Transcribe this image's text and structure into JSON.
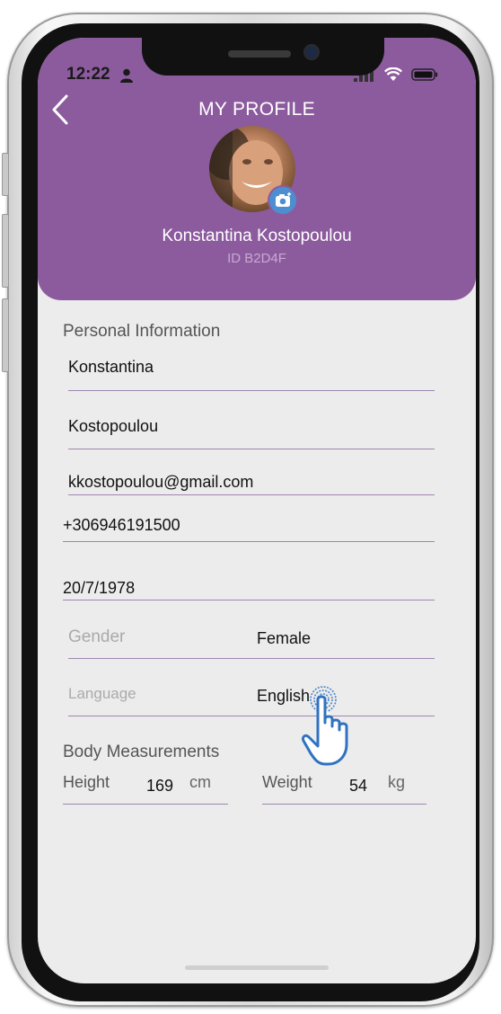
{
  "status_bar": {
    "time": "12:22"
  },
  "header": {
    "title": "MY PROFILE",
    "user_name": "Konstantina Kostopoulou",
    "user_id": "ID B2D4F"
  },
  "personal": {
    "section_title": "Personal Information",
    "first_name": "Konstantina",
    "last_name": "Kostopoulou",
    "email": "kkostopoulou@gmail.com",
    "phone": "+306946191500",
    "birth_date": "20/7/1978",
    "gender_label": "Gender",
    "gender_value": "Female",
    "language_label": "Language",
    "language_value": "English"
  },
  "body": {
    "section_title": "Body Measurements",
    "height_label": "Height",
    "height_value": "169",
    "height_unit": "cm",
    "weight_label": "Weight",
    "weight_value": "54",
    "weight_unit": "kg"
  },
  "colors": {
    "header_bg": "#8c5b9e",
    "screen_bg": "#ececec",
    "underline": "#9f86ae",
    "camera_badge": "#4d8ed0"
  },
  "icons": [
    "person-icon",
    "signal-icon",
    "wifi-icon",
    "battery-icon",
    "back-arrow-icon",
    "camera-icon",
    "tap-hand-icon"
  ]
}
